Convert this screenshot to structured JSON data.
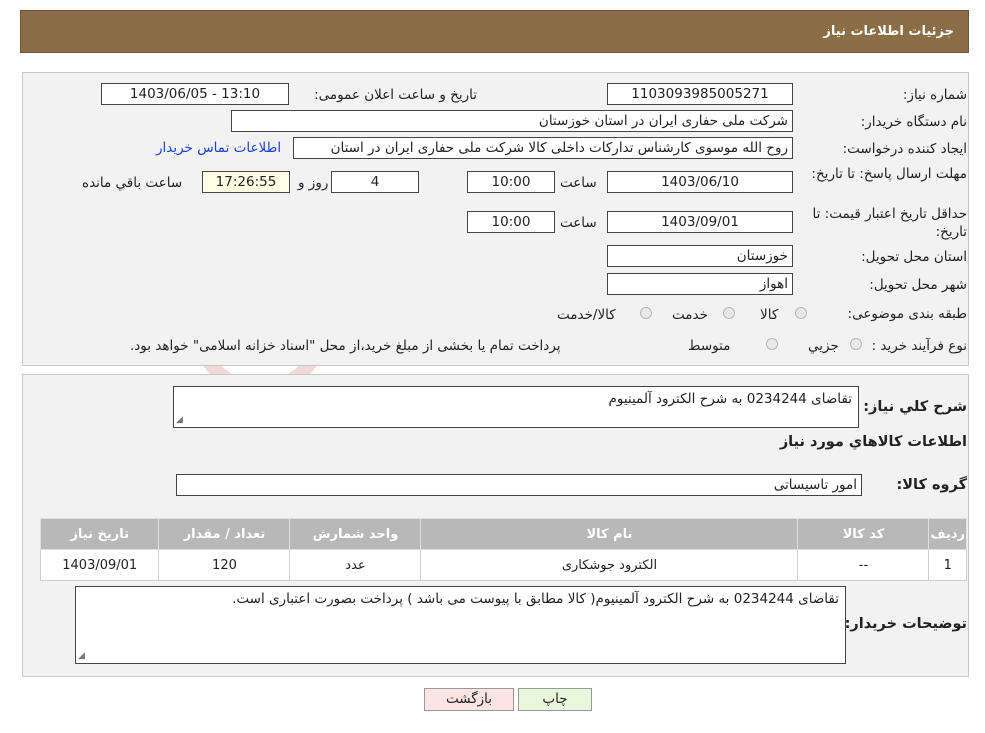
{
  "header": {
    "title": "جزئیات اطلاعات نیاز"
  },
  "form": {
    "need_number": {
      "label": "شماره نیاز:",
      "value": "1103093985005271"
    },
    "announce_datetime": {
      "label": "تاریخ و ساعت اعلان عمومی:",
      "value": "1403/06/05 - 13:10"
    },
    "buyer_org": {
      "label": "نام دستگاه خریدار:",
      "value": "شرکت ملی حفاری ایران در استان خوزستان"
    },
    "requester": {
      "label": "ایجاد کننده درخواست:",
      "value": "روح الله موسوی کارشناس تدارکات داخلی کالا شرکت ملی حفاری ایران در استان",
      "link": "اطلاعات تماس خریدار"
    },
    "deadline": {
      "label": "مهلت ارسال پاسخ: تا تاریخ:",
      "date": "1403/06/10",
      "time_label": "ساعت",
      "time": "10:00",
      "days": "4",
      "days_label": "روز و",
      "remaining": "17:26:55",
      "remaining_label": "ساعت باقي مانده"
    },
    "price_validity": {
      "label": "حداقل تاریخ اعتبار قیمت: تا تاریخ:",
      "date": "1403/09/01",
      "time_label": "ساعت",
      "time": "10:00"
    },
    "province": {
      "label": "استان محل تحویل:",
      "value": "خوزستان"
    },
    "city": {
      "label": "شهر محل تحویل:",
      "value": "اهواز"
    },
    "category": {
      "label": "طبقه بندی موضوعی:",
      "options": [
        "کالا",
        "خدمت",
        "کالا/خدمت"
      ]
    },
    "purchase_type": {
      "label": "نوع فرآیند خرید :",
      "options": [
        "جزيي",
        "متوسط"
      ],
      "note": "پرداخت تمام یا بخشی از مبلغ خرید،از محل \"اسناد خزانه اسلامی\" خواهد بود."
    }
  },
  "details": {
    "summary_label": "شرح کلي نياز:",
    "summary": "تقاضای 0234244 به شرح الکترود آلمینیوم",
    "goods_title": "اطلاعات كالاهاي مورد نياز",
    "group_label": "گروه کالا:",
    "group": "امور تاسیساتی",
    "table": {
      "headers": [
        "رديف",
        "کد کالا",
        "نام کالا",
        "واحد شمارش",
        "تعداد / مقدار",
        "تاریخ نیاز"
      ],
      "rows": [
        [
          "1",
          "--",
          "الکترود جوشکاری",
          "عدد",
          "120",
          "1403/09/01"
        ]
      ]
    },
    "buyer_notes_label": "توضیحات خریدار:",
    "buyer_notes": "تقاضای 0234244 به شرح الکترود آلمینیوم( کالا مطابق با پیوست می باشد ) پرداخت بصورت اعتباری است."
  },
  "buttons": {
    "print": "چاپ",
    "back": "بازگشت"
  },
  "watermark": {
    "text": "AriaTender.neT"
  },
  "colors": {
    "header": "#8b6d46",
    "back_button": "#fce4e4",
    "print_button": "#e9f8dc"
  }
}
